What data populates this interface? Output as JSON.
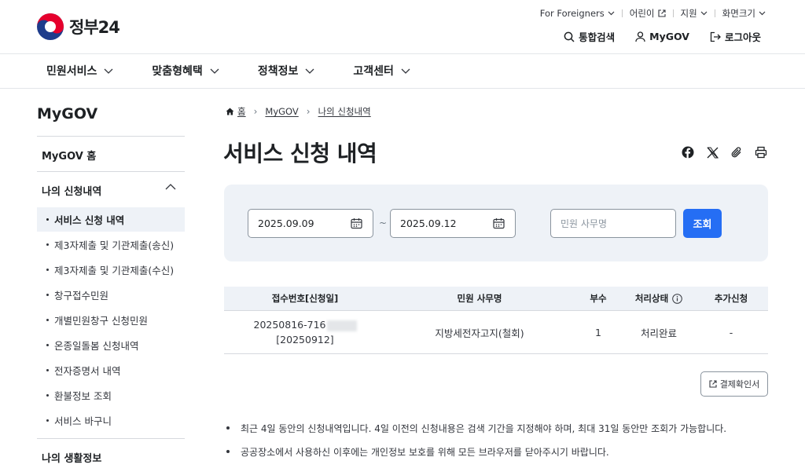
{
  "header": {
    "logo_text": "정부24",
    "util_links": [
      {
        "label": "For Foreigners",
        "icon": "chevron-down-icon"
      },
      {
        "label": "어린이",
        "icon": "external-link-icon"
      },
      {
        "label": "지원",
        "icon": "chevron-down-icon"
      },
      {
        "label": "화면크기",
        "icon": "chevron-down-icon"
      }
    ],
    "actions": [
      {
        "label": "통합검색",
        "icon": "search-icon"
      },
      {
        "label": "MyGOV",
        "icon": "user-icon"
      },
      {
        "label": "로그아웃",
        "icon": "logout-icon"
      }
    ]
  },
  "gnb": [
    "민원서비스",
    "맞춤형혜택",
    "정책정보",
    "고객센터"
  ],
  "sidebar": {
    "title": "MyGOV",
    "home": "MyGOV 홈",
    "section": "나의 신청내역",
    "items": [
      "서비스 신청 내역",
      "제3자제출 및 기관제출(송신)",
      "제3자제출 및 기관제출(수신)",
      "창구접수민원",
      "개별민원창구 신청민원",
      "온종일돌봄 신청내역",
      "전자증명서 내역",
      "환불정보 조회",
      "서비스 바구니"
    ],
    "active_index": 0,
    "next_section": "나의 생활정보"
  },
  "breadcrumb": [
    "홈",
    "MyGOV",
    "나의 신청내역"
  ],
  "page_title": "서비스 신청 내역",
  "search": {
    "start_date": "2025.09.09",
    "end_date": "2025.09.12",
    "separator": "~",
    "keyword_placeholder": "민원 사무명",
    "button": "조회"
  },
  "table": {
    "headers": [
      "접수번호[신청일]",
      "민원 사무명",
      "부수",
      "처리상태",
      "추가신청"
    ],
    "rows": [
      {
        "receipt_no": "20250816-716",
        "date": "[20250912]",
        "name": "지방세전자고지(철회)",
        "copies": "1",
        "status": "처리완료",
        "extra": "-"
      }
    ]
  },
  "result_button": "결제확인서",
  "notes": [
    "최근 4일 동안의 신청내역입니다. 4일 이전의 신청내용은 검색 기간을 지정해야 하며, 최대 31일 동안만 조회가 가능합니다.",
    "공공장소에서 사용하신 이후에는 개인정보 보호를 위해 모든 브라우저를 닫아주시기 바랍니다."
  ],
  "colors": {
    "primary": "#256ef4",
    "search_bg": "#eef2f7",
    "logo_red": "#e6002d",
    "logo_blue": "#1e3c8c"
  }
}
